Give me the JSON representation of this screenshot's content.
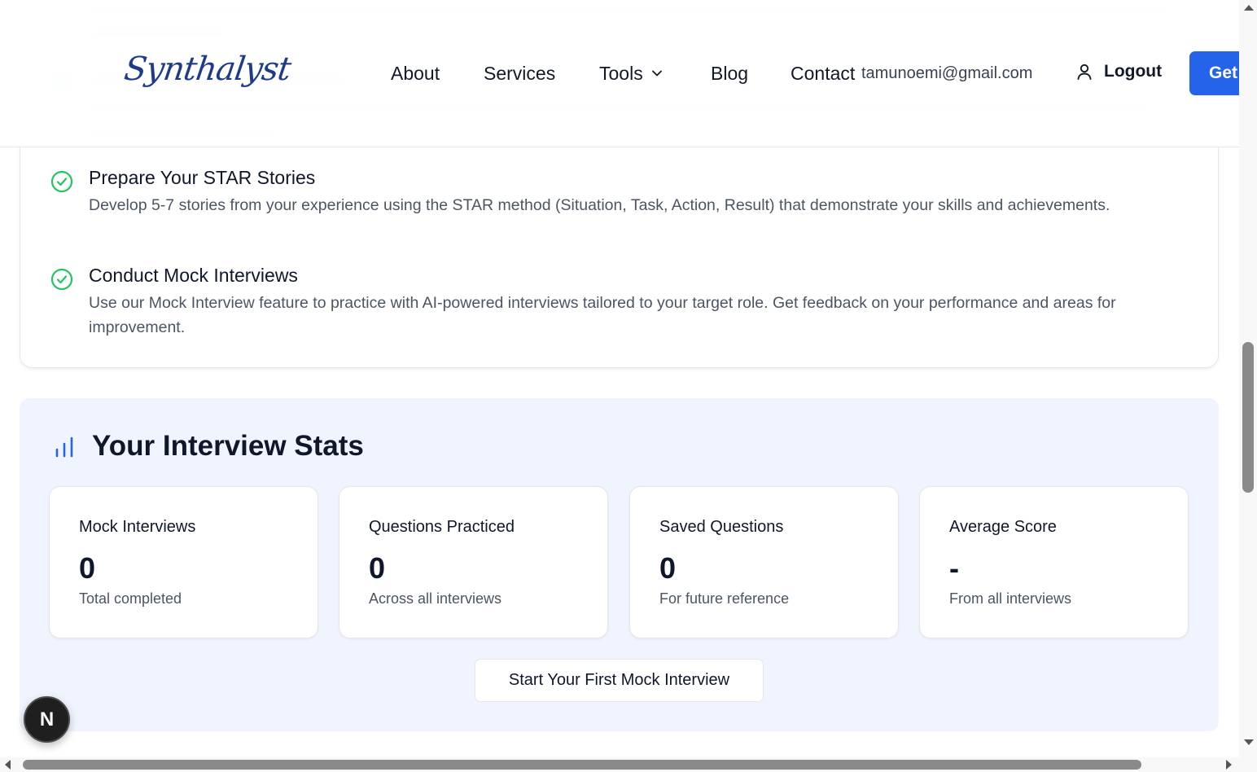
{
  "header": {
    "logo": "Synthalyst",
    "nav": {
      "about": "About",
      "services": "Services",
      "tools": "Tools",
      "blog": "Blog",
      "contact": "Contact"
    },
    "user_email": "tamunoemi@gmail.com",
    "logout_label": "Logout",
    "cta_label": "Get"
  },
  "tips": [
    {
      "title": "Prepare Your STAR Stories",
      "description": "Develop 5-7 stories from your experience using the STAR method (Situation, Task, Action, Result) that demonstrate your skills and achievements."
    },
    {
      "title": "Conduct Mock Interviews",
      "description": "Use our Mock Interview feature to practice with AI-powered interviews tailored to your target role. Get feedback on your performance and areas for improvement."
    }
  ],
  "stats": {
    "title": "Your Interview Stats",
    "cards": [
      {
        "label": "Mock Interviews",
        "value": "0",
        "sub": "Total completed"
      },
      {
        "label": "Questions Practiced",
        "value": "0",
        "sub": "Across all interviews"
      },
      {
        "label": "Saved Questions",
        "value": "0",
        "sub": "For future reference"
      },
      {
        "label": "Average Score",
        "value": "-",
        "sub": "From all interviews"
      }
    ],
    "start_button": "Start Your First Mock Interview"
  },
  "badge": {
    "letter": "N"
  },
  "colors": {
    "accent": "#2563eb",
    "check": "#22c55e",
    "stats_bg": "#f0f4fe",
    "logo": "#1e3a8a"
  },
  "icons": {
    "tip": "check-circle-icon",
    "stats": "bar-chart-icon",
    "tools": "chevron-down-icon",
    "logout": "user-icon"
  }
}
